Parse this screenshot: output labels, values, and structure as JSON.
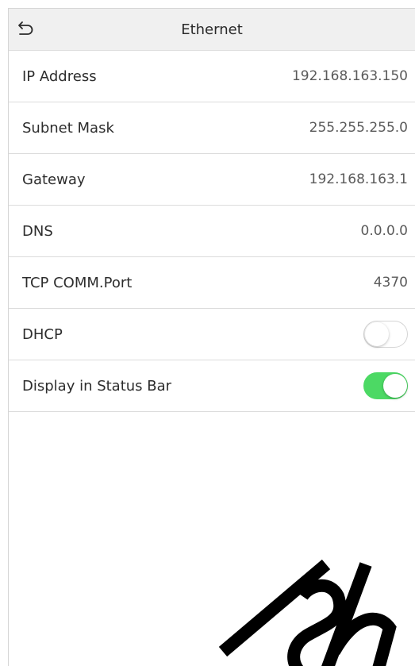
{
  "header": {
    "title": "Ethernet",
    "back_icon": "back-arrow-icon"
  },
  "rows": [
    {
      "label": "IP Address",
      "value": "192.168.163.150",
      "type": "text"
    },
    {
      "label": "Subnet Mask",
      "value": "255.255.255.0",
      "type": "text"
    },
    {
      "label": "Gateway",
      "value": "192.168.163.1",
      "type": "text"
    },
    {
      "label": "DNS",
      "value": "0.0.0.0",
      "type": "text"
    },
    {
      "label": "TCP COMM.Port",
      "value": "4370",
      "type": "text"
    },
    {
      "label": "DHCP",
      "value": "off",
      "type": "toggle"
    },
    {
      "label": "Display in Status Bar",
      "value": "on",
      "type": "toggle"
    }
  ],
  "colors": {
    "header_bg": "#f0f0f0",
    "toggle_on": "#4cd964",
    "toggle_off_border": "#d4d4d4",
    "divider": "#dcdcdc"
  }
}
